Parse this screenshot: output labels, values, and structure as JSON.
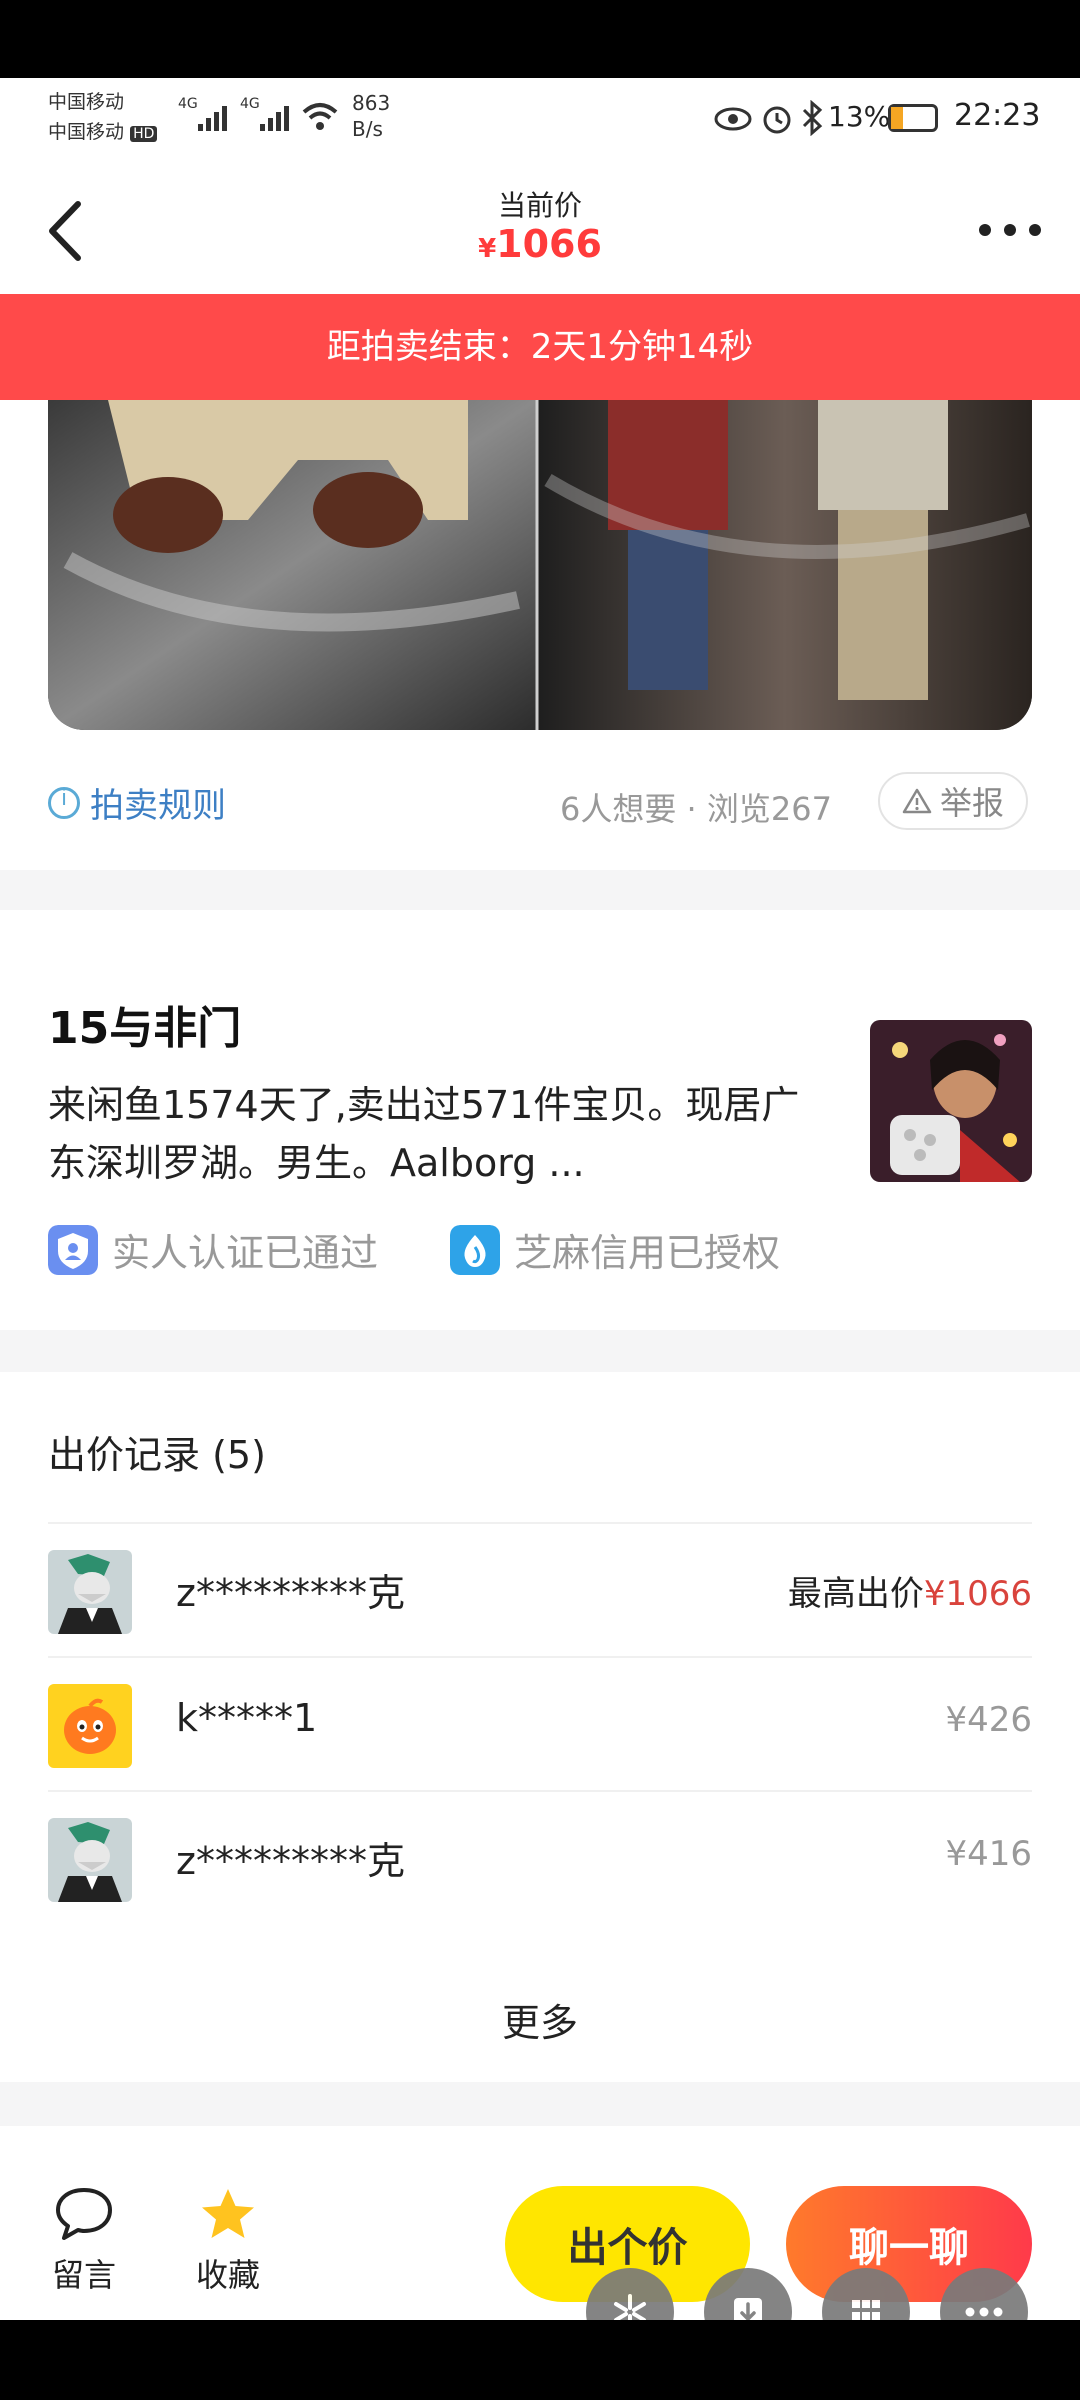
{
  "status_bar": {
    "carrier1": "中国移动",
    "carrier2": "中国移动",
    "network1": "4G",
    "network2": "4G",
    "hd": "HD",
    "speed_value": "863",
    "speed_unit": "B/s",
    "battery": "13%",
    "time": "22:23"
  },
  "header": {
    "price_label": "当前价",
    "currency": "¥",
    "price": "1066"
  },
  "countdown": "距拍卖结束：2天1分钟14秒",
  "rule_row": {
    "rule_label": "拍卖规则",
    "stats": "6人想要 · 浏览267",
    "report_label": "举报"
  },
  "seller": {
    "name": "15与非门",
    "description": "来闲鱼1574天了,卖出过571件宝贝。现居广东深圳罗湖。男生。Aalborg ...",
    "verify_realname": "实人认证已通过",
    "verify_credit": "芝麻信用已授权"
  },
  "bids": {
    "title": "出价记录 (5)",
    "rows": [
      {
        "user": "z*********克",
        "label": "最高出价",
        "amount": "¥1066"
      },
      {
        "user": "k*****1",
        "label": "",
        "amount": "¥426"
      },
      {
        "user": "z*********克",
        "label": "",
        "amount": "¥416"
      }
    ],
    "more": "更多"
  },
  "bottom_bar": {
    "comment_label": "留言",
    "favorite_label": "收藏",
    "bid_button": "出个价",
    "chat_button": "聊一聊"
  },
  "colors": {
    "accent_red": "#ff4a4a",
    "price_red": "#ff3b3b",
    "bid_yellow": "#ffe600",
    "link_blue": "#3d7fc4"
  }
}
